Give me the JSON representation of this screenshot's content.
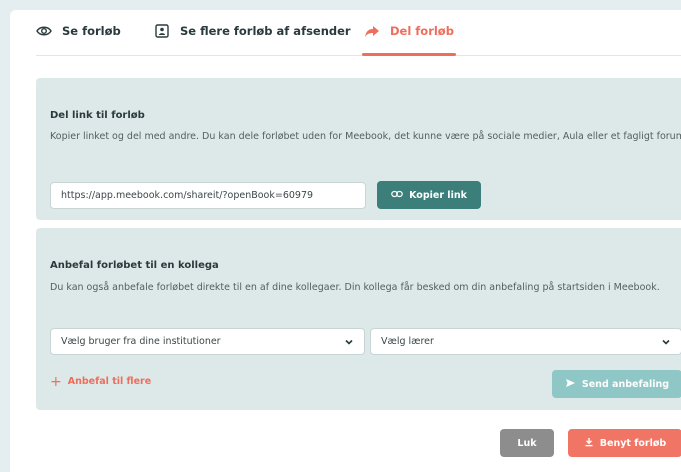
{
  "tabs": [
    {
      "label": "Se forløb",
      "icon": "eye-icon"
    },
    {
      "label": "Se flere forløb af afsender",
      "icon": "user-card-icon"
    },
    {
      "label": "Del forløb",
      "icon": "share-arrow-icon"
    }
  ],
  "share_link": {
    "title": "Del link til forløb",
    "description": "Kopier linket og del med andre. Du kan dele forløbet uden for Meebook, det kunne være på sociale medier, Aula eller et fagligt forum",
    "url_value": "https://app.meebook.com/shareit/?openBook=60979",
    "copy_label": "Kopier link"
  },
  "recommend": {
    "title": "Anbefal forløbet til en kollega",
    "description": "Du kan også anbefale forløbet direkte til en af dine kollegaer. Din kollega får besked om din anbefaling på startsiden i Meebook.",
    "select_user_placeholder": "Vælg bruger fra dine institutioner",
    "select_teacher_placeholder": "Vælg lærer",
    "add_more_label": "Anbefal til flere",
    "send_label": "Send anbefaling"
  },
  "footer": {
    "close_label": "Luk",
    "use_label": "Benyt forløb"
  },
  "colors": {
    "accent": "#ef6d5c",
    "panel_bg": "#dde9e8",
    "primary_teal": "#3c7f7a",
    "disabled_teal": "#8fc6c6",
    "neutral_button": "#8d8d8d"
  }
}
